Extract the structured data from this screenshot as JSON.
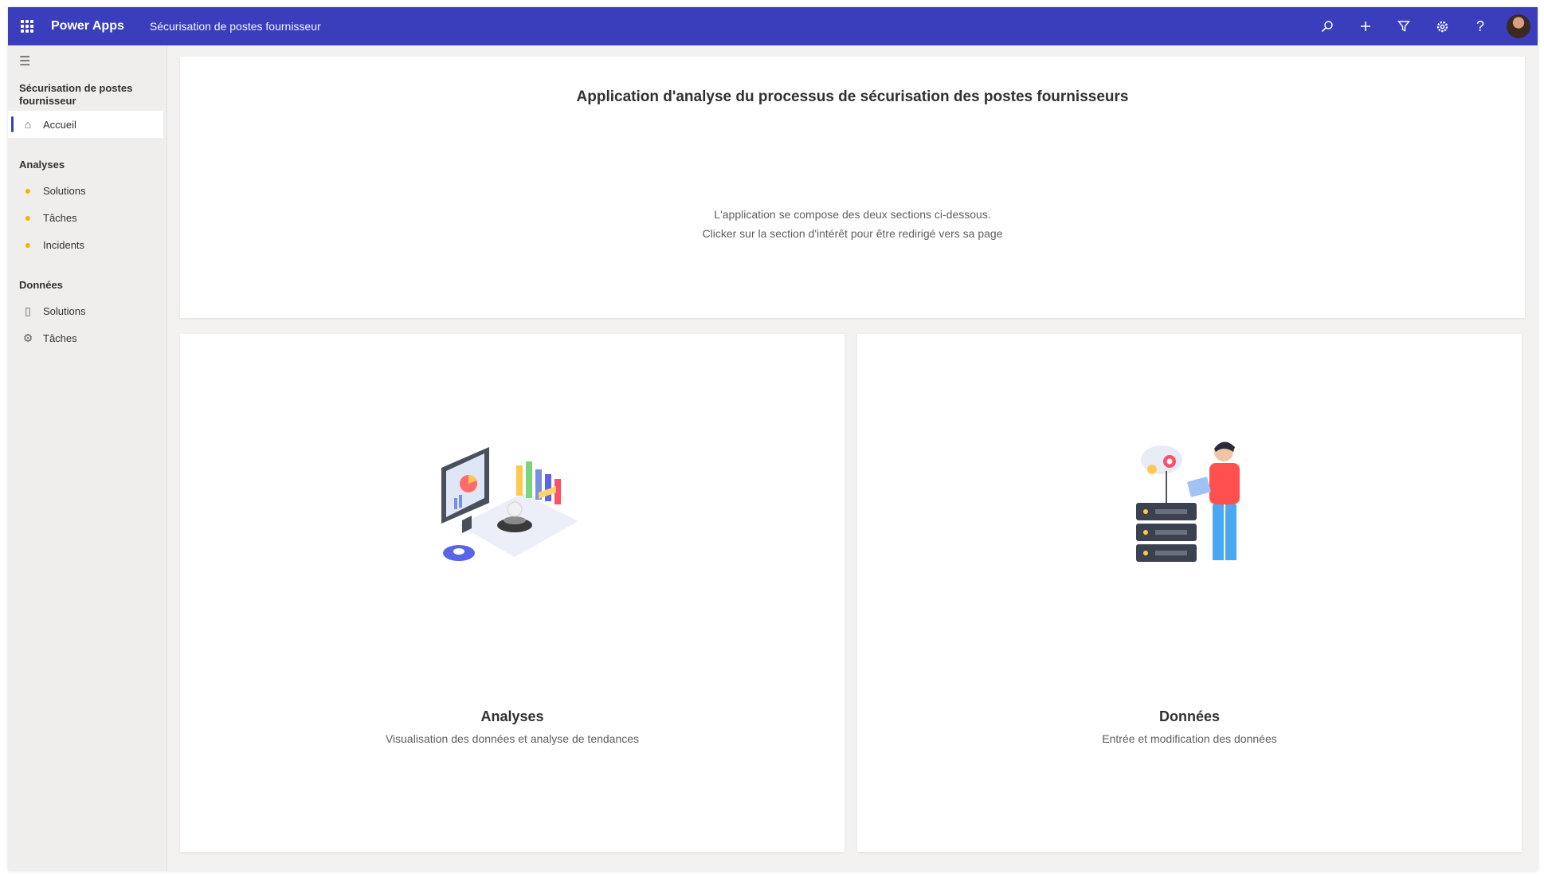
{
  "topbar": {
    "brand": "Power Apps",
    "app_name": "Sécurisation de postes fournisseur",
    "icons": [
      "search-icon",
      "plus-icon",
      "filter-icon",
      "settings-icon",
      "help-icon"
    ],
    "color": "#3a3ebc"
  },
  "sidebar": {
    "collapse_icon": "hamburger-icon",
    "app_title": "Sécurisation de postes fournisseur",
    "home": {
      "label": "Accueil",
      "icon": "home-icon"
    },
    "groups": [
      {
        "label": "Analyses",
        "items": [
          {
            "label": "Solutions",
            "icon": "lightbulb-icon"
          },
          {
            "label": "Tâches",
            "icon": "lightbulb-icon"
          },
          {
            "label": "Incidents",
            "icon": "lightbulb-icon"
          }
        ]
      },
      {
        "label": "Données",
        "items": [
          {
            "label": "Solutions",
            "icon": "document-icon"
          },
          {
            "label": "Tâches",
            "icon": "gear-icon"
          }
        ]
      }
    ]
  },
  "main": {
    "title": "Application d'analyse du processus de sécurisation des postes fournisseurs",
    "subtitle_line1": "L'application se compose des deux sections ci-dessous.",
    "subtitle_line2": "Clicker sur la section d'intérêt pour être redirigé vers sa page",
    "cards": [
      {
        "title": "Analyses",
        "description": "Visualisation des données et analyse de tendances",
        "illustration": "analytics-dashboard-illustration"
      },
      {
        "title": "Données",
        "description": "Entrée et modification des données",
        "illustration": "data-server-illustration"
      }
    ]
  }
}
